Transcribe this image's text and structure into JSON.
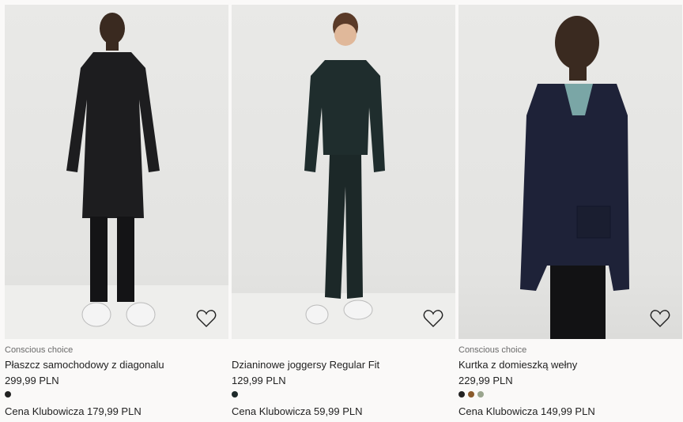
{
  "products": [
    {
      "badge": "Conscious choice",
      "title": "Płaszcz samochodowy z diagonalu",
      "price": "299,99 PLN",
      "swatches": [
        "#222222"
      ],
      "club_price": "Cena Klubowicza 179,99 PLN"
    },
    {
      "badge": "",
      "title": "Dzianinowe joggersy Regular Fit",
      "price": "129,99 PLN",
      "swatches": [
        "#1e2a2a"
      ],
      "club_price": "Cena Klubowicza 59,99 PLN"
    },
    {
      "badge": "Conscious choice",
      "title": "Kurtka z domieszką wełny",
      "price": "229,99 PLN",
      "swatches": [
        "#222222",
        "#8a5a2c",
        "#9aa58e"
      ],
      "club_price": "Cena Klubowicza 149,99 PLN"
    }
  ],
  "icons": {
    "favorite": "heart-outline-icon"
  }
}
